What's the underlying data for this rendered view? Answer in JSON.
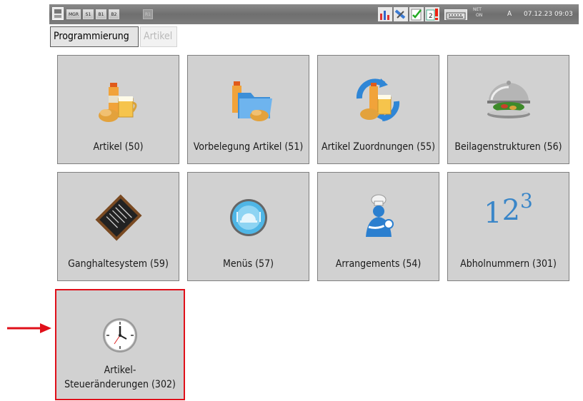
{
  "topbar": {
    "buttons": [
      "MGR",
      "S1",
      "B1",
      "B2",
      "R1"
    ],
    "net_line1": "NET",
    "net_line2": "ON",
    "user": "A",
    "datetime": "07.12.23  09:03",
    "icons": [
      "report-icon",
      "tools-icon",
      "checklist-icon",
      "alert-icon",
      "keyboard-icon"
    ]
  },
  "breadcrumb": {
    "current": "Programmierung",
    "next": "Artikel"
  },
  "tiles": [
    {
      "label": "Artikel (50)"
    },
    {
      "label": "Vorbelegung Artikel (51)"
    },
    {
      "label": "Artikel Zuordnungen (55)"
    },
    {
      "label": "Beilagenstrukturen (56)"
    },
    {
      "label": "Ganghaltesystem (59)"
    },
    {
      "label": "Menüs (57)"
    },
    {
      "label": "Arrangements (54)"
    },
    {
      "label": "Abholnummern (301)",
      "icon_text": "1",
      "icon_sup": "2",
      "icon_sup2": "3"
    },
    {
      "label_line1": "Artikel-",
      "label_line2": "Steueränderungen (302)"
    }
  ],
  "colors": {
    "accent": "#e0101a",
    "tile": "#d1d1d1"
  }
}
